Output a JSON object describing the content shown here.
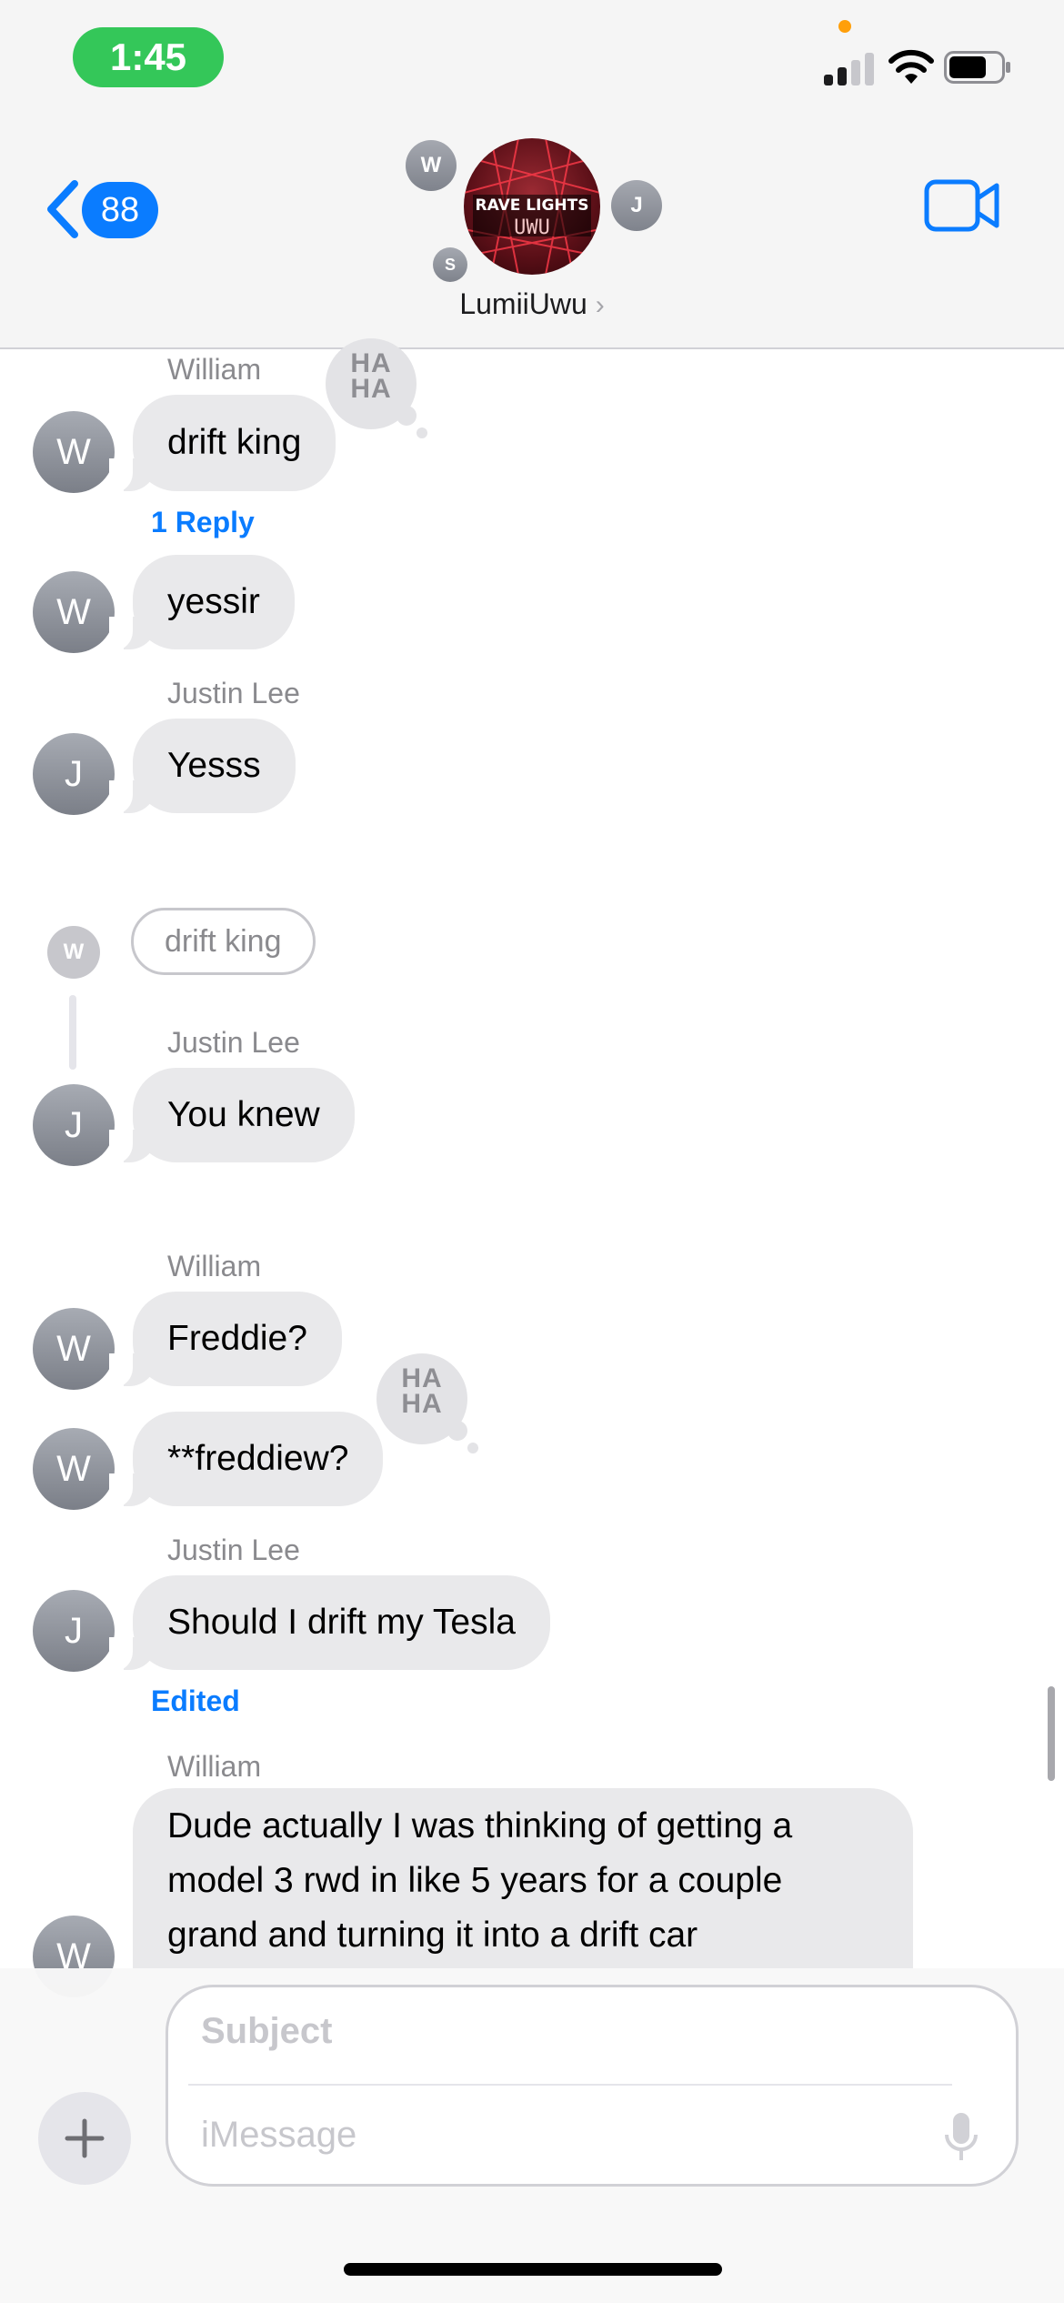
{
  "status_bar": {
    "time": "1:45"
  },
  "header": {
    "back_count": "88",
    "group_name": "LumiiUwu",
    "group_avatar_line1": "RAVE LIGHTS",
    "group_avatar_line2": "UWU",
    "member_initials": [
      "W",
      "J",
      "S"
    ]
  },
  "messages": {
    "m1": {
      "sender": "William",
      "text": "drift king",
      "avatar": "W",
      "tapback": "HA HA",
      "reply": "1 Reply"
    },
    "m2": {
      "text": "yessir",
      "avatar": "W"
    },
    "m3": {
      "sender": "Justin Lee",
      "text": "Yesss",
      "avatar": "J"
    },
    "thread": {
      "quote": "drift king",
      "quote_avatar": "W"
    },
    "m4": {
      "sender": "Justin Lee",
      "text": "You knew",
      "avatar": "J"
    },
    "m5": {
      "sender": "William",
      "text": "Freddie?",
      "avatar": "W"
    },
    "m6": {
      "text": "**freddiew?",
      "avatar": "W",
      "tapback": "HA HA"
    },
    "m7": {
      "sender": "Justin Lee",
      "text": "Should I drift my Tesla",
      "avatar": "J",
      "edited": "Edited"
    },
    "m8": {
      "sender": "William",
      "lines": [
        "Dude actually I was thinking of getting a",
        "model 3 rwd in like 5 years for a couple",
        "grand and turning it into a drift car"
      ],
      "avatar": "W"
    }
  },
  "compose": {
    "subject_placeholder": "Subject",
    "message_placeholder": "iMessage"
  },
  "colors": {
    "accent": "#0a7cff",
    "bubble": "#e9e9eb",
    "status_green": "#34c759"
  }
}
